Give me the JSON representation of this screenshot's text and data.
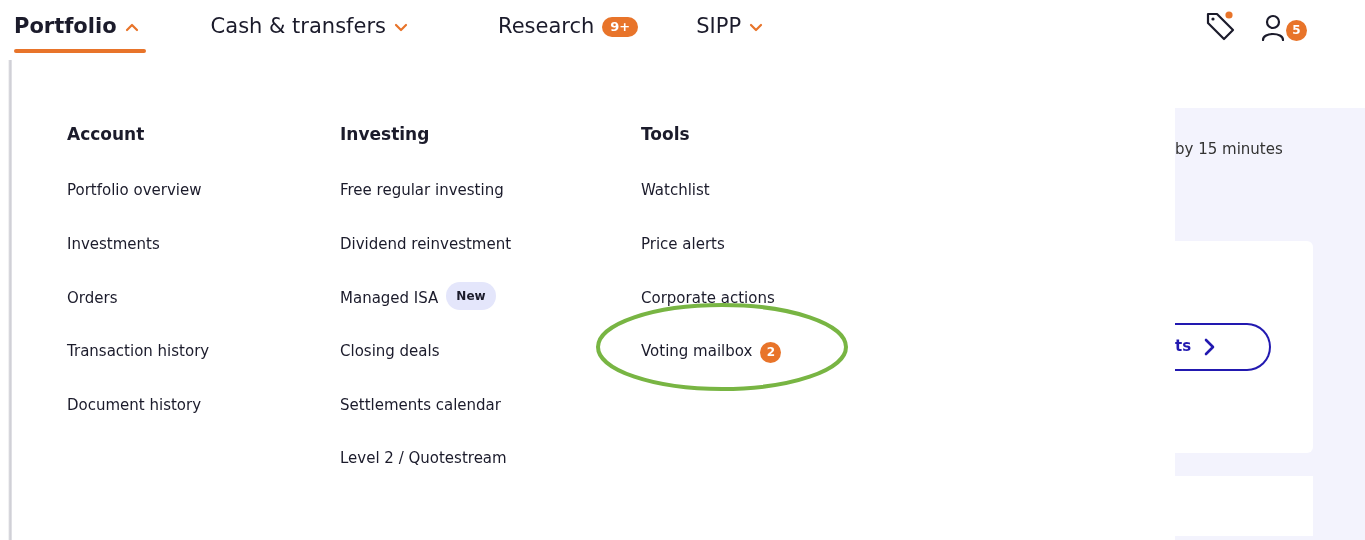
{
  "nav": [
    {
      "label": "Portfolio",
      "selected": true,
      "expanded": true
    },
    {
      "label": "Cash & transfers",
      "selected": false,
      "expanded": false
    },
    {
      "label": "Research",
      "selected": false,
      "badge": "9+"
    },
    {
      "label": "SIPP",
      "selected": false,
      "expanded": false
    }
  ],
  "header_icons": {
    "alerts_dot": true,
    "account_badge": "5"
  },
  "menu": [
    {
      "title": "Account",
      "items": [
        {
          "label": "Portfolio overview"
        },
        {
          "label": "Investments"
        },
        {
          "label": "Orders"
        },
        {
          "label": "Transaction history"
        },
        {
          "label": "Document history"
        }
      ]
    },
    {
      "title": "Investing",
      "items": [
        {
          "label": "Free regular investing"
        },
        {
          "label": "Dividend reinvestment"
        },
        {
          "label": "Managed ISA",
          "tag": "New"
        },
        {
          "label": "Closing deals"
        },
        {
          "label": "Settlements calendar"
        },
        {
          "label": "Level 2 / Quotestream"
        }
      ]
    },
    {
      "title": "Tools",
      "items": [
        {
          "label": "Watchlist"
        },
        {
          "label": "Price alerts"
        },
        {
          "label": "Corporate actions"
        },
        {
          "label": "Voting mailbox",
          "count": "2",
          "highlighted": true
        }
      ]
    }
  ],
  "background": {
    "notice": "by 15 minutes",
    "button": "ts"
  }
}
